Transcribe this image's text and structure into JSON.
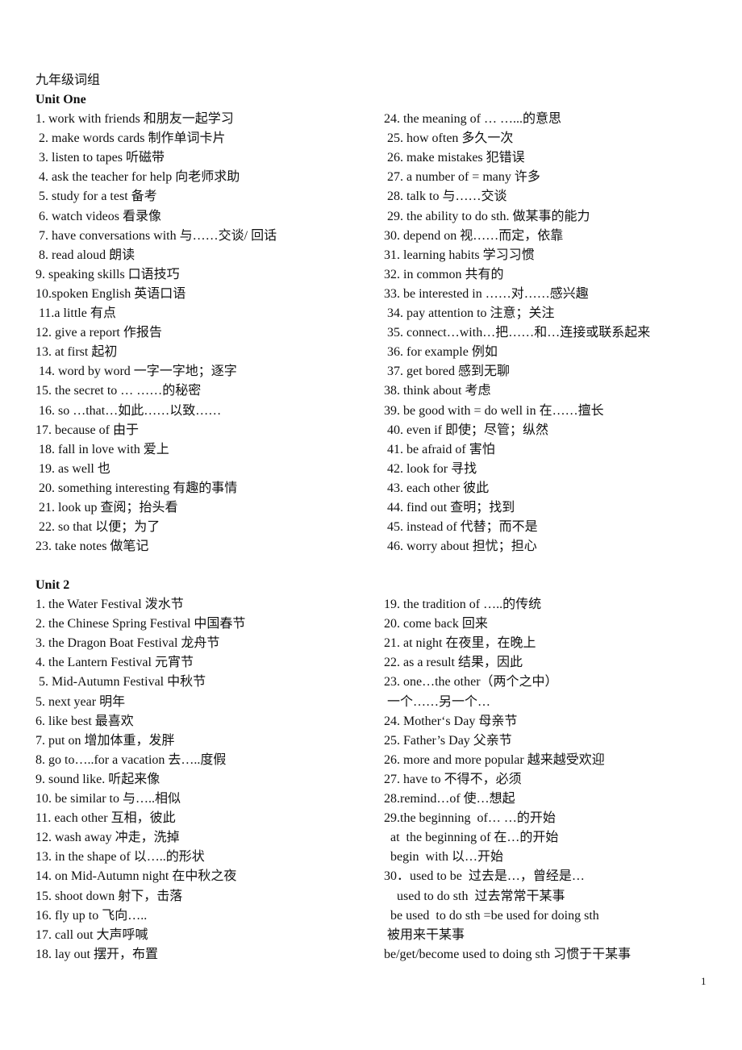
{
  "document": {
    "title": "九年级词组",
    "page_number": "1"
  },
  "units": [
    {
      "heading": "Unit One",
      "left": [
        "1. work with friends 和朋友一起学习",
        " 2. make words cards 制作单词卡片",
        " 3. listen to tapes 听磁带",
        " 4. ask the teacher for help 向老师求助",
        " 5. study for a test 备考",
        " 6. watch videos 看录像",
        " 7. have conversations with 与……交谈/ 回话",
        " 8. read aloud 朗读",
        "9. speaking skills 口语技巧",
        "10.spoken English 英语口语",
        " 11.a little 有点",
        "12. give a report 作报告",
        "13. at first 起初",
        " 14. word by word 一字一字地；逐字",
        "15. the secret to … ……的秘密",
        " 16. so …that…如此……以致……",
        "17. because of 由于",
        " 18. fall in love with 爱上",
        " 19. as well 也",
        " 20. something interesting 有趣的事情",
        " 21. look up 查阅；抬头看",
        " 22. so that 以便；为了",
        "23. take notes 做笔记"
      ],
      "right": [
        "24. the meaning of … …...的意思",
        " 25. how often 多久一次",
        " 26. make mistakes 犯错误",
        " 27. a number of = many 许多",
        " 28. talk to 与……交谈",
        " 29. the ability to do sth. 做某事的能力",
        "30. depend on 视……而定，依靠",
        "31. learning habits 学习习惯",
        "32. in common 共有的",
        "33. be interested in ……对……感兴趣",
        " 34. pay attention to 注意；关注",
        " 35. connect…with…把……和…连接或联系起来",
        " 36. for example 例如",
        " 37. get bored 感到无聊",
        "38. think about 考虑",
        "39. be good with = do well in 在……擅长",
        " 40. even if 即使；尽管；纵然",
        " 41. be afraid of 害怕",
        " 42. look for 寻找",
        " 43. each other 彼此",
        " 44. find out 查明；找到",
        " 45. instead of 代替；而不是",
        " 46. worry about 担忧；担心"
      ]
    },
    {
      "heading": "Unit 2",
      "left": [
        "1. the Water Festival 泼水节",
        "2. the Chinese Spring Festival 中国春节",
        "3. the Dragon Boat Festival 龙舟节",
        "4. the Lantern Festival 元宵节",
        " 5. Mid-Autumn Festival 中秋节",
        "5. next year 明年",
        "6. like best 最喜欢",
        "7. put on 增加体重，发胖",
        "8. go to…..for a vacation 去…..度假",
        "9. sound like. 听起来像",
        "10. be similar to 与…..相似",
        "11. each other 互相，彼此",
        "12. wash away 冲走，洗掉",
        "13. in the shape of 以…..的形状",
        "14. on Mid-Autumn night 在中秋之夜",
        "15. shoot down 射下，击落",
        "16. fly up to 飞向…..",
        "17. call out 大声呼喊",
        "18. lay out 摆开，布置"
      ],
      "right": [
        "19. the tradition of …..的传统",
        "20. come back 回来",
        "21. at night 在夜里，在晚上",
        "22. as a result 结果，因此",
        "23. one…the other（两个之中）",
        " 一个……另一个…",
        "24. Mother‘s Day 母亲节",
        "25. Father’s Day 父亲节",
        "26. more and more popular 越来越受欢迎",
        "27. have to 不得不，必须",
        "28.remind…of 使…想起",
        "29.the beginning  of… …的开始",
        "  at  the beginning of 在…的开始",
        "  begin  with 以…开始",
        "30．used to be  过去是…，曾经是…",
        "    used to do sth  过去常常干某事",
        "  be used  to do sth =be used for doing sth",
        " 被用来干某事",
        "be/get/become used to doing sth 习惯于干某事"
      ]
    }
  ]
}
